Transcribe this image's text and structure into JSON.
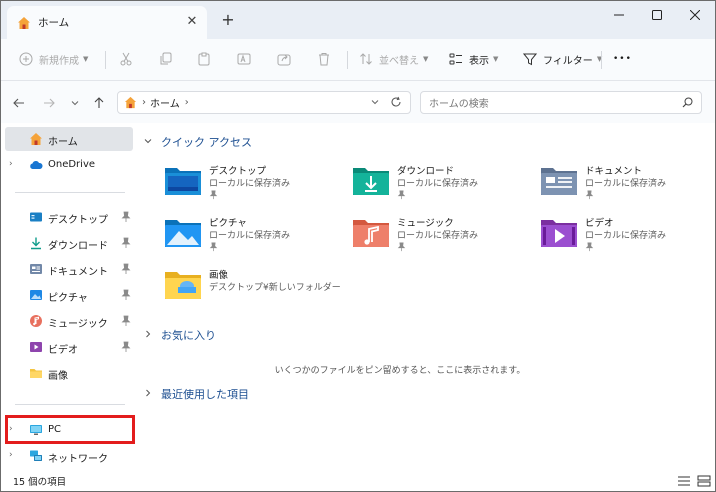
{
  "tab": {
    "title": "ホーム"
  },
  "toolbar": {
    "new_label": "新規作成",
    "sort_label": "並べ替え",
    "view_label": "表示",
    "filter_label": "フィルター",
    "more_label": "•••"
  },
  "address": {
    "crumb": "ホーム"
  },
  "search": {
    "placeholder": "ホームの検索"
  },
  "sidebar": {
    "home": "ホーム",
    "onedrive": "OneDrive",
    "desktop": "デスクトップ",
    "downloads": "ダウンロード",
    "documents": "ドキュメント",
    "pictures": "ピクチャ",
    "music": "ミュージック",
    "videos": "ビデオ",
    "images": "画像",
    "pc": "PC",
    "network": "ネットワーク"
  },
  "main": {
    "quick_access": "クイック アクセス",
    "favorites": "お気に入り",
    "recent": "最近使用した項目",
    "favorites_empty": "いくつかのファイルをピン留めすると、ここに表示されます。",
    "tiles": [
      {
        "name": "デスクトップ",
        "sub": "ローカルに保存済み"
      },
      {
        "name": "ダウンロード",
        "sub": "ローカルに保存済み"
      },
      {
        "name": "ドキュメント",
        "sub": "ローカルに保存済み"
      },
      {
        "name": "ピクチャ",
        "sub": "ローカルに保存済み"
      },
      {
        "name": "ミュージック",
        "sub": "ローカルに保存済み"
      },
      {
        "name": "ビデオ",
        "sub": "ローカルに保存済み"
      },
      {
        "name": "画像",
        "sub": "デスクトップ¥新しいフォルダー"
      }
    ]
  },
  "status": {
    "count": "15 個の項目"
  },
  "colors": {
    "accent": "#1d4f91",
    "highlight": "#e31c1c",
    "selected": "#e1e4e8"
  }
}
